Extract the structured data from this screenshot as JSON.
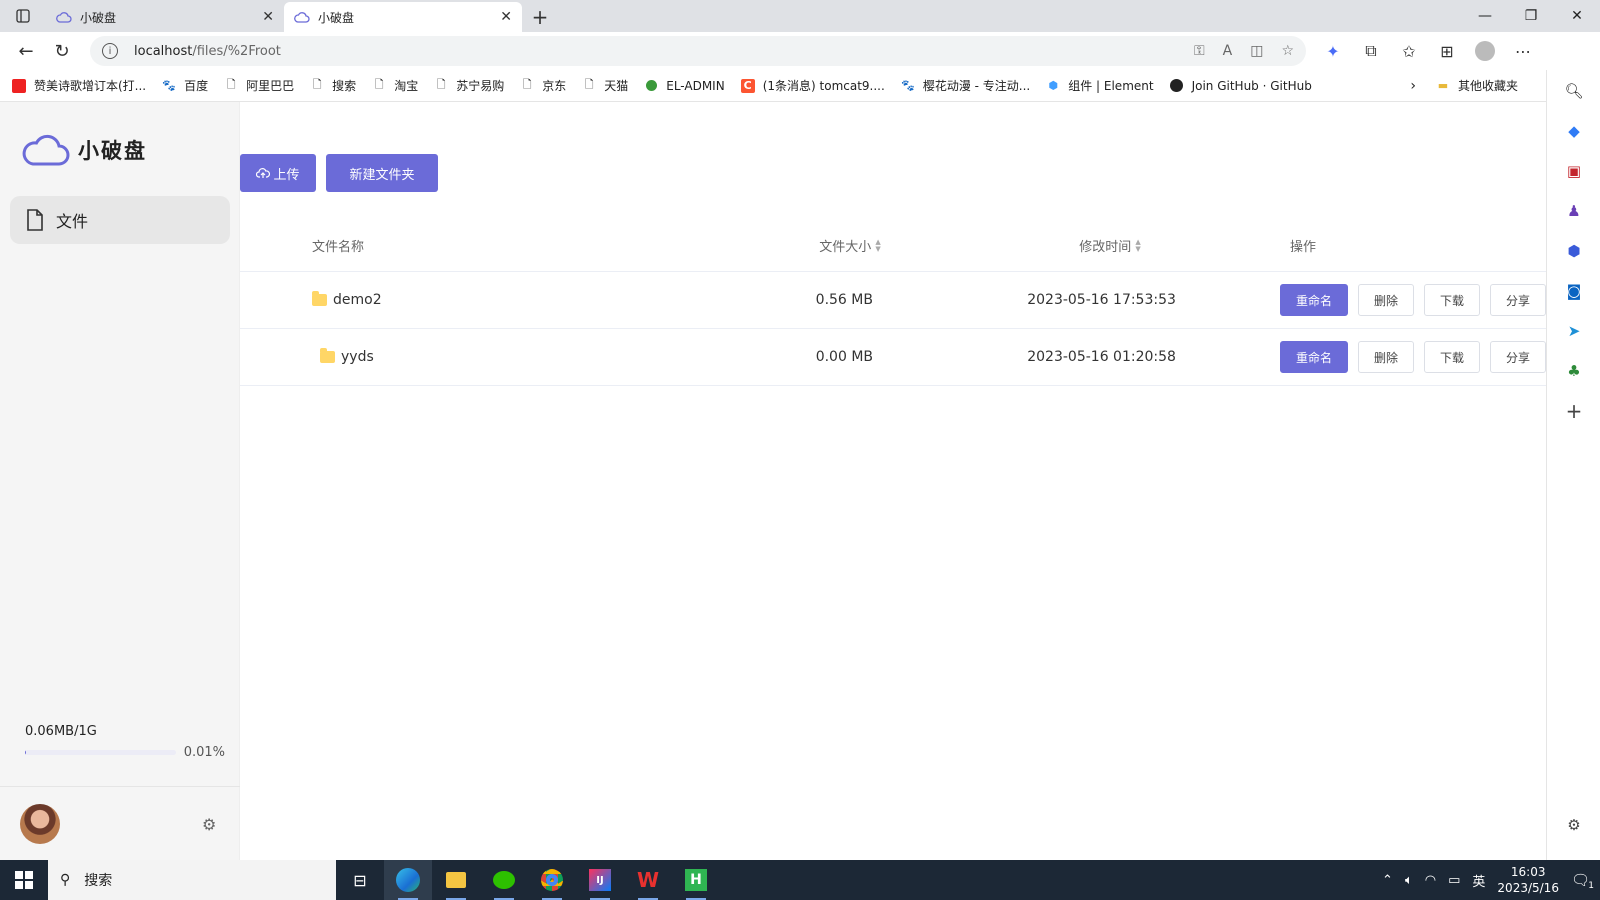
{
  "browser": {
    "tabs": [
      {
        "title": "小破盘",
        "active": false
      },
      {
        "title": "小破盘",
        "active": true
      }
    ],
    "url_host": "localhost",
    "url_path": "/files/%2Froot",
    "bookmarks": [
      {
        "label": "赞美诗歌增订本(打...",
        "icon": "bookmark-red-icon"
      },
      {
        "label": "百度",
        "icon": "baidu-paw-icon"
      },
      {
        "label": "阿里巴巴",
        "icon": "page-icon"
      },
      {
        "label": "搜索",
        "icon": "page-icon"
      },
      {
        "label": "淘宝",
        "icon": "page-icon"
      },
      {
        "label": "苏宁易购",
        "icon": "page-icon"
      },
      {
        "label": "京东",
        "icon": "page-icon"
      },
      {
        "label": "天猫",
        "icon": "page-icon"
      },
      {
        "label": "EL-ADMIN",
        "icon": "green-dot-icon"
      },
      {
        "label": "(1条消息) tomcat9....",
        "icon": "csdn-icon"
      },
      {
        "label": "樱花动漫 - 专注动...",
        "icon": "baidu-paw-icon"
      },
      {
        "label": "组件 | Element",
        "icon": "element-icon"
      },
      {
        "label": "Join GitHub · GitHub",
        "icon": "github-icon"
      }
    ],
    "other_bookmarks": "其他收藏夹"
  },
  "app": {
    "name": "小破盘",
    "menu_files": "文件",
    "upload_label": "上传",
    "new_folder_label": "新建文件夹",
    "storage_used": "0.06MB/1G",
    "storage_percent": "0.01%",
    "storage_fraction": 0.0001,
    "accent_color": "#6b6bd8"
  },
  "table": {
    "headers": {
      "name": "文件名称",
      "size": "文件大小",
      "time": "修改时间",
      "actions": "操作"
    },
    "rows": [
      {
        "name": "demo2",
        "size": "0.56 MB",
        "time": "2023-05-16 17:53:53"
      },
      {
        "name": "yyds",
        "size": "0.00 MB",
        "time": "2023-05-16 01:20:58"
      }
    ],
    "actions": {
      "rename": "重命名",
      "delete": "删除",
      "download": "下载",
      "share": "分享"
    }
  },
  "taskbar": {
    "search_label": "搜索",
    "ime": "英",
    "time": "16:03",
    "date": "2023/5/16",
    "notification_count": "1"
  }
}
